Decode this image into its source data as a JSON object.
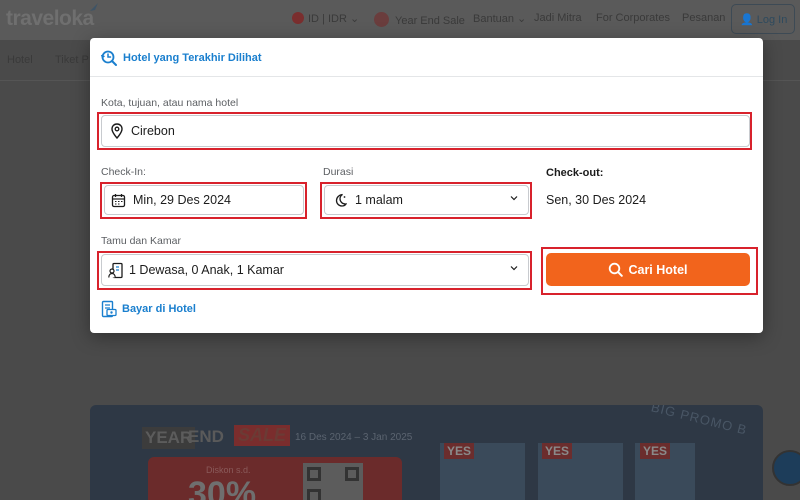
{
  "background": {
    "logo": "traveloka",
    "top_nav": {
      "currency": "ID | IDR",
      "year_end_sale": "Year End Sale",
      "help": "Bantuan",
      "partner": "Jadi Mitra",
      "corporates": "For Corporates",
      "orders": "Pesanan",
      "login": "Log In"
    },
    "sub_nav": [
      "Hotel",
      "Tiket P"
    ],
    "banner": {
      "year": "YEAR",
      "end": "END",
      "sale": "SALE",
      "dates": "16 Des 2024 – 3 Jan 2025",
      "discount_label": "Diskon s.d.",
      "discount_value": "30%",
      "yes_labels": [
        "YES",
        "YES",
        "YES"
      ],
      "promo_text": "BIG PROMO B"
    }
  },
  "modal": {
    "recent_hotels_label": "Hotel yang Terakhir Dilihat",
    "destination": {
      "label": "Kota, tujuan, atau nama hotel",
      "value": "Cirebon"
    },
    "check_in": {
      "label": "Check-In:",
      "value": "Min, 29 Des 2024"
    },
    "duration": {
      "label": "Durasi",
      "value": "1 malam"
    },
    "check_out": {
      "label": "Check-out:",
      "value": "Sen, 30 Des 2024"
    },
    "guests": {
      "label": "Tamu dan Kamar",
      "value": "1 Dewasa, 0 Anak, 1 Kamar"
    },
    "search_button": "Cari Hotel",
    "pay_at_hotel": "Bayar di Hotel"
  },
  "colors": {
    "accent_blue": "#1a7fce",
    "search_orange": "#f2641c",
    "highlight_red": "#d8222c"
  }
}
